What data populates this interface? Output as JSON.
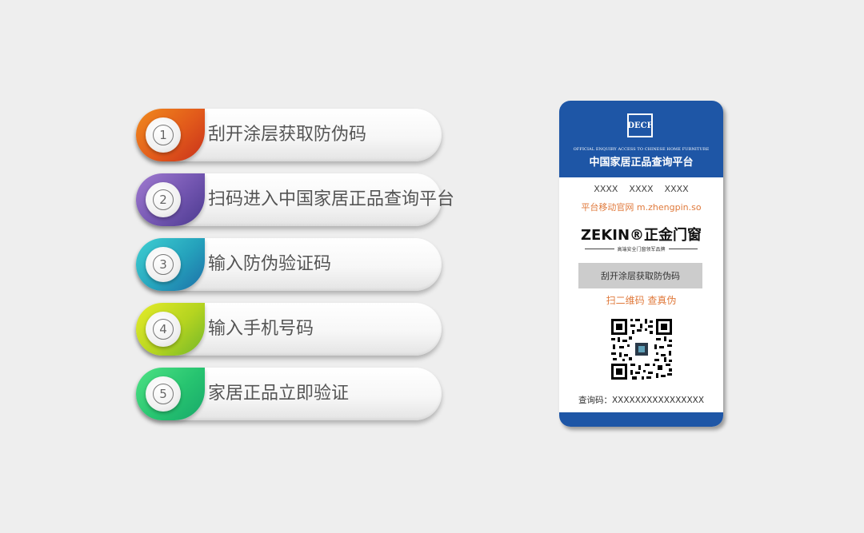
{
  "steps": [
    {
      "num": "①",
      "label": "刮开涂层获取防伪码",
      "color_from": "#f08a1c",
      "color_to": "#c8311b"
    },
    {
      "num": "②",
      "label": "扫码进入中国家居正品查询平台",
      "color_from": "#8a64c2",
      "color_to": "#4b3a8f"
    },
    {
      "num": "③",
      "label": "输入防伪验证码",
      "color_from": "#2ec0c8",
      "color_to": "#1d6fa8"
    },
    {
      "num": "④",
      "label": "输入手机号码",
      "color_from": "#d8e21a",
      "color_to": "#72b72a"
    },
    {
      "num": "⑤",
      "label": "家居正品立即验证",
      "color_from": "#35d874",
      "color_to": "#17a86a"
    }
  ],
  "card": {
    "logo": "DECF",
    "header_en": "OFFICIAL ENQUIRY ACCESS TO CHINESE HOME FURNITURE",
    "header_cn": "中国家居正品查询平台",
    "placeholder_row": "XXXX    XXXX    XXXX",
    "site_row": "平台移动官网 m.zhengpin.so",
    "brand": "ZEKIN®正金门窗",
    "tagline": "高端安全门窗领军品牌",
    "scratch_label": "刮开涂层获取防伪码",
    "scan_row": "扫二维码 查真伪",
    "query_row": "查询码：XXXXXXXXXXXXXXXX",
    "accent_color": "#1e56a6",
    "orange_color": "#e07a3c"
  }
}
